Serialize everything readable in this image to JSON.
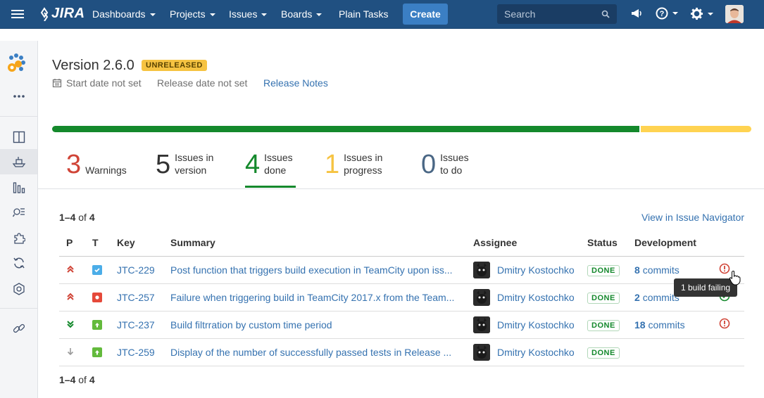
{
  "nav": {
    "logo": "JIRA",
    "items": [
      {
        "label": "Dashboards"
      },
      {
        "label": "Projects"
      },
      {
        "label": "Issues"
      },
      {
        "label": "Boards"
      },
      {
        "label": "Plain Tasks"
      }
    ],
    "create_label": "Create",
    "search_placeholder": "Search"
  },
  "version": {
    "title": "Version 2.6.0",
    "status_badge": "UNRELEASED",
    "start_date": "Start date not set",
    "release_date": "Release date not set",
    "release_notes": "Release Notes"
  },
  "progress": {
    "done_fraction": 0.84,
    "in_progress_fraction": 0.16,
    "done_color": "#14892c",
    "in_progress_color": "#ffd351"
  },
  "stats": [
    {
      "num": "3",
      "label": "Warnings",
      "color": "#d04437"
    },
    {
      "num": "5",
      "label": "Issues in version",
      "color": "#333333"
    },
    {
      "num": "4",
      "label": "Issues done",
      "color": "#14892c"
    },
    {
      "num": "1",
      "label": "Issues in progress",
      "color": "#f6c342"
    },
    {
      "num": "0",
      "label": "Issues to do",
      "color": "#4a6785"
    }
  ],
  "list": {
    "range_top": "1–4",
    "of_word": "of",
    "total": "4",
    "view_navigator": "View in Issue Navigator",
    "headers": {
      "p": "P",
      "t": "T",
      "key": "Key",
      "summary": "Summary",
      "assignee": "Assignee",
      "status": "Status",
      "development": "Development"
    },
    "rows": [
      {
        "priority": "highest-priority-icon",
        "type": "task-icon",
        "key": "JTC-229",
        "summary": "Post function that triggers build execution in TeamCity upon iss...",
        "assignee": "Dmitry Kostochko",
        "status": "DONE",
        "commits_num": "8",
        "commits_word": "commits",
        "build": "failing"
      },
      {
        "priority": "highest-priority-icon",
        "type": "bug-icon",
        "key": "JTC-257",
        "summary": "Failure when triggering build in TeamCity 2017.x from the Team...",
        "assignee": "Dmitry Kostochko",
        "status": "DONE",
        "commits_num": "2",
        "commits_word": "commits",
        "build": "passing"
      },
      {
        "priority": "lowest-priority-icon",
        "type": "improvement-icon",
        "key": "JTC-237",
        "summary": "Build filtrration by custom time period",
        "assignee": "Dmitry Kostochko",
        "status": "DONE",
        "commits_num": "18",
        "commits_word": "commits",
        "build": "failing"
      },
      {
        "priority": "low-priority-icon",
        "type": "improvement-icon",
        "key": "JTC-259",
        "summary": "Display of the number of successfully passed tests in Release ...",
        "assignee": "Dmitry Kostochko",
        "status": "DONE",
        "commits_num": "",
        "commits_word": "",
        "build": "none"
      }
    ],
    "range_bottom": "1–4"
  },
  "tooltip": "1 build failing"
}
